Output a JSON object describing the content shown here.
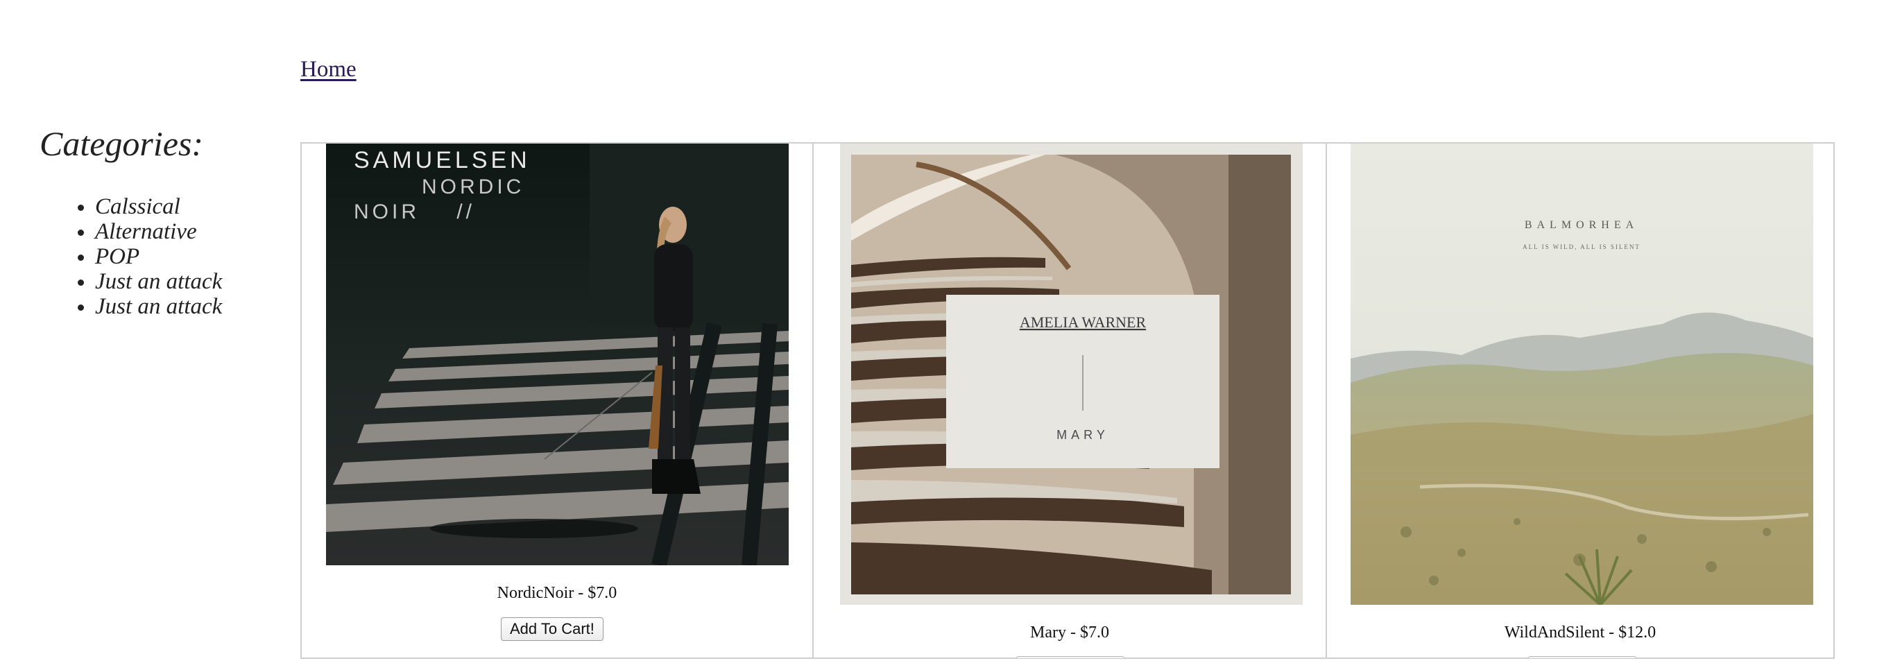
{
  "nav": {
    "home_label": "Home"
  },
  "sidebar": {
    "title": "Categories:",
    "items": [
      {
        "label": "Calssical"
      },
      {
        "label": "Alternative"
      },
      {
        "label": "POP"
      },
      {
        "label": "Just an attack"
      },
      {
        "label": "Just an attack"
      }
    ]
  },
  "products": [
    {
      "name": "NordicNoir",
      "price": "$7.0",
      "caption": "NordicNoir - $7.0",
      "button_label": "Add To Cart!",
      "cover": {
        "artist": "SAMUELSEN",
        "title_lines": [
          "NORDIC",
          "NOIR    //"
        ]
      }
    },
    {
      "name": "Mary",
      "price": "$7.0",
      "caption": "Mary - $7.0",
      "cover": {
        "artist": "AMELIA WARNER",
        "title": "MARY"
      }
    },
    {
      "name": "WildAndSilent",
      "price": "$12.0",
      "caption": "WildAndSilent - $12.0",
      "cover": {
        "artist": "BALMORHEA",
        "subtitle": "ALL IS WILD, ALL IS SILENT"
      }
    }
  ],
  "colors": {
    "link": "#2a1a55",
    "border": "#cfcfcf"
  }
}
